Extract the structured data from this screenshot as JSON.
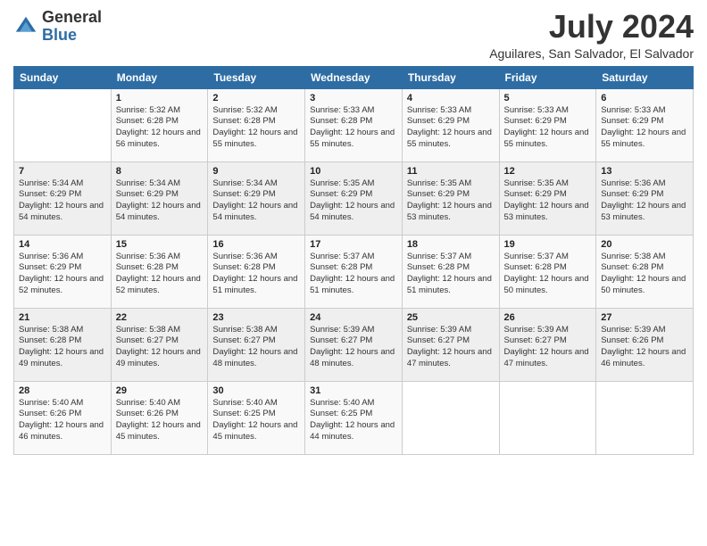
{
  "header": {
    "logo_general": "General",
    "logo_blue": "Blue",
    "title": "July 2024",
    "location": "Aguilares, San Salvador, El Salvador"
  },
  "days_of_week": [
    "Sunday",
    "Monday",
    "Tuesday",
    "Wednesday",
    "Thursday",
    "Friday",
    "Saturday"
  ],
  "weeks": [
    [
      {
        "day": "",
        "sunrise": "",
        "sunset": "",
        "daylight": ""
      },
      {
        "day": "1",
        "sunrise": "Sunrise: 5:32 AM",
        "sunset": "Sunset: 6:28 PM",
        "daylight": "Daylight: 12 hours and 56 minutes."
      },
      {
        "day": "2",
        "sunrise": "Sunrise: 5:32 AM",
        "sunset": "Sunset: 6:28 PM",
        "daylight": "Daylight: 12 hours and 55 minutes."
      },
      {
        "day": "3",
        "sunrise": "Sunrise: 5:33 AM",
        "sunset": "Sunset: 6:28 PM",
        "daylight": "Daylight: 12 hours and 55 minutes."
      },
      {
        "day": "4",
        "sunrise": "Sunrise: 5:33 AM",
        "sunset": "Sunset: 6:29 PM",
        "daylight": "Daylight: 12 hours and 55 minutes."
      },
      {
        "day": "5",
        "sunrise": "Sunrise: 5:33 AM",
        "sunset": "Sunset: 6:29 PM",
        "daylight": "Daylight: 12 hours and 55 minutes."
      },
      {
        "day": "6",
        "sunrise": "Sunrise: 5:33 AM",
        "sunset": "Sunset: 6:29 PM",
        "daylight": "Daylight: 12 hours and 55 minutes."
      }
    ],
    [
      {
        "day": "7",
        "sunrise": "Sunrise: 5:34 AM",
        "sunset": "Sunset: 6:29 PM",
        "daylight": "Daylight: 12 hours and 54 minutes."
      },
      {
        "day": "8",
        "sunrise": "Sunrise: 5:34 AM",
        "sunset": "Sunset: 6:29 PM",
        "daylight": "Daylight: 12 hours and 54 minutes."
      },
      {
        "day": "9",
        "sunrise": "Sunrise: 5:34 AM",
        "sunset": "Sunset: 6:29 PM",
        "daylight": "Daylight: 12 hours and 54 minutes."
      },
      {
        "day": "10",
        "sunrise": "Sunrise: 5:35 AM",
        "sunset": "Sunset: 6:29 PM",
        "daylight": "Daylight: 12 hours and 54 minutes."
      },
      {
        "day": "11",
        "sunrise": "Sunrise: 5:35 AM",
        "sunset": "Sunset: 6:29 PM",
        "daylight": "Daylight: 12 hours and 53 minutes."
      },
      {
        "day": "12",
        "sunrise": "Sunrise: 5:35 AM",
        "sunset": "Sunset: 6:29 PM",
        "daylight": "Daylight: 12 hours and 53 minutes."
      },
      {
        "day": "13",
        "sunrise": "Sunrise: 5:36 AM",
        "sunset": "Sunset: 6:29 PM",
        "daylight": "Daylight: 12 hours and 53 minutes."
      }
    ],
    [
      {
        "day": "14",
        "sunrise": "Sunrise: 5:36 AM",
        "sunset": "Sunset: 6:29 PM",
        "daylight": "Daylight: 12 hours and 52 minutes."
      },
      {
        "day": "15",
        "sunrise": "Sunrise: 5:36 AM",
        "sunset": "Sunset: 6:28 PM",
        "daylight": "Daylight: 12 hours and 52 minutes."
      },
      {
        "day": "16",
        "sunrise": "Sunrise: 5:36 AM",
        "sunset": "Sunset: 6:28 PM",
        "daylight": "Daylight: 12 hours and 51 minutes."
      },
      {
        "day": "17",
        "sunrise": "Sunrise: 5:37 AM",
        "sunset": "Sunset: 6:28 PM",
        "daylight": "Daylight: 12 hours and 51 minutes."
      },
      {
        "day": "18",
        "sunrise": "Sunrise: 5:37 AM",
        "sunset": "Sunset: 6:28 PM",
        "daylight": "Daylight: 12 hours and 51 minutes."
      },
      {
        "day": "19",
        "sunrise": "Sunrise: 5:37 AM",
        "sunset": "Sunset: 6:28 PM",
        "daylight": "Daylight: 12 hours and 50 minutes."
      },
      {
        "day": "20",
        "sunrise": "Sunrise: 5:38 AM",
        "sunset": "Sunset: 6:28 PM",
        "daylight": "Daylight: 12 hours and 50 minutes."
      }
    ],
    [
      {
        "day": "21",
        "sunrise": "Sunrise: 5:38 AM",
        "sunset": "Sunset: 6:28 PM",
        "daylight": "Daylight: 12 hours and 49 minutes."
      },
      {
        "day": "22",
        "sunrise": "Sunrise: 5:38 AM",
        "sunset": "Sunset: 6:27 PM",
        "daylight": "Daylight: 12 hours and 49 minutes."
      },
      {
        "day": "23",
        "sunrise": "Sunrise: 5:38 AM",
        "sunset": "Sunset: 6:27 PM",
        "daylight": "Daylight: 12 hours and 48 minutes."
      },
      {
        "day": "24",
        "sunrise": "Sunrise: 5:39 AM",
        "sunset": "Sunset: 6:27 PM",
        "daylight": "Daylight: 12 hours and 48 minutes."
      },
      {
        "day": "25",
        "sunrise": "Sunrise: 5:39 AM",
        "sunset": "Sunset: 6:27 PM",
        "daylight": "Daylight: 12 hours and 47 minutes."
      },
      {
        "day": "26",
        "sunrise": "Sunrise: 5:39 AM",
        "sunset": "Sunset: 6:27 PM",
        "daylight": "Daylight: 12 hours and 47 minutes."
      },
      {
        "day": "27",
        "sunrise": "Sunrise: 5:39 AM",
        "sunset": "Sunset: 6:26 PM",
        "daylight": "Daylight: 12 hours and 46 minutes."
      }
    ],
    [
      {
        "day": "28",
        "sunrise": "Sunrise: 5:40 AM",
        "sunset": "Sunset: 6:26 PM",
        "daylight": "Daylight: 12 hours and 46 minutes."
      },
      {
        "day": "29",
        "sunrise": "Sunrise: 5:40 AM",
        "sunset": "Sunset: 6:26 PM",
        "daylight": "Daylight: 12 hours and 45 minutes."
      },
      {
        "day": "30",
        "sunrise": "Sunrise: 5:40 AM",
        "sunset": "Sunset: 6:25 PM",
        "daylight": "Daylight: 12 hours and 45 minutes."
      },
      {
        "day": "31",
        "sunrise": "Sunrise: 5:40 AM",
        "sunset": "Sunset: 6:25 PM",
        "daylight": "Daylight: 12 hours and 44 minutes."
      },
      {
        "day": "",
        "sunrise": "",
        "sunset": "",
        "daylight": ""
      },
      {
        "day": "",
        "sunrise": "",
        "sunset": "",
        "daylight": ""
      },
      {
        "day": "",
        "sunrise": "",
        "sunset": "",
        "daylight": ""
      }
    ]
  ]
}
